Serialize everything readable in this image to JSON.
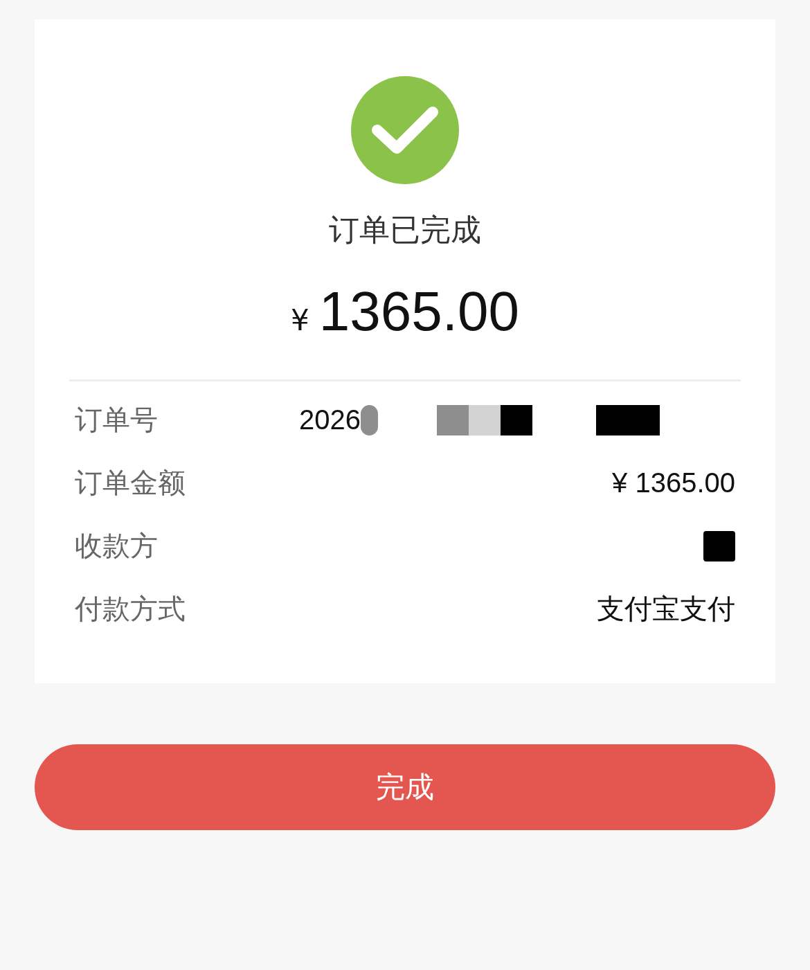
{
  "status": {
    "title": "订单已完成",
    "currency": "¥",
    "amount": "1365.00"
  },
  "details": [
    {
      "kind": "order",
      "label": "订单号",
      "value": "2026"
    },
    {
      "kind": "text",
      "label": "订单金额",
      "value": "¥ 1365.00"
    },
    {
      "kind": "hidden",
      "label": "收款方"
    },
    {
      "kind": "text",
      "label": "付款方式",
      "value": "支付宝支付"
    }
  ],
  "button": {
    "label": "完成"
  }
}
